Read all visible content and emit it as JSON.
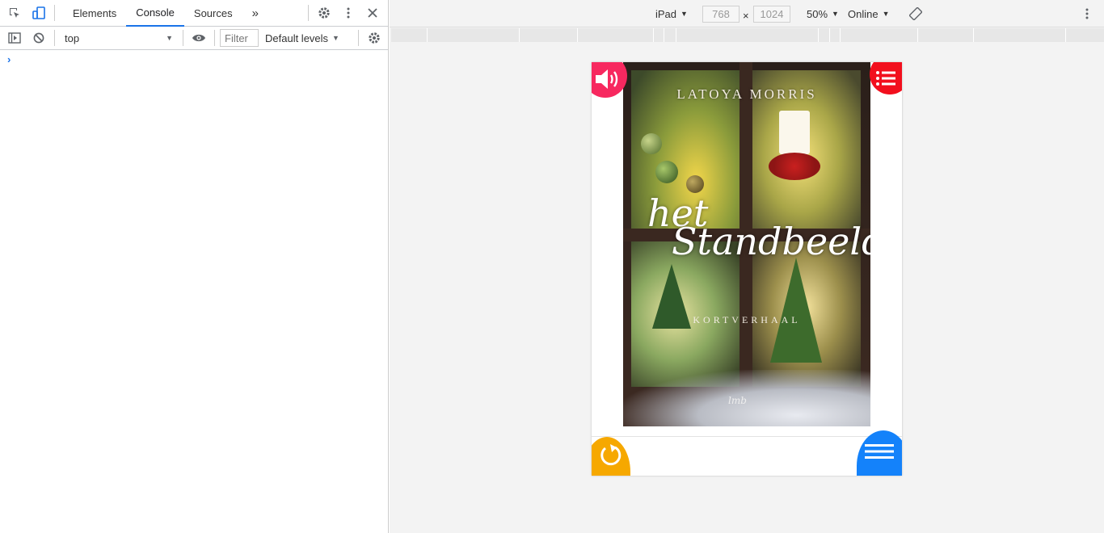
{
  "devtools": {
    "tabs": [
      {
        "label": "Elements",
        "active": false
      },
      {
        "label": "Console",
        "active": true
      },
      {
        "label": "Sources",
        "active": false
      }
    ],
    "more_tabs_glyph": "»",
    "context": "top",
    "filter_placeholder": "Filter",
    "levels": "Default levels",
    "prompt_glyph": "›",
    "icons": [
      "inspect-icon",
      "device-toggle-icon",
      "settings-icon",
      "kebab-icon",
      "close-icon",
      "sidebar-icon",
      "clear-icon",
      "eye-icon"
    ]
  },
  "device_toolbar": {
    "device": "iPad",
    "width": "768",
    "height": "1024",
    "times": "×",
    "zoom": "50%",
    "network": "Online"
  },
  "book": {
    "author": "LATOYA MORRIS",
    "title_line1": "het",
    "title_line2": "Standbeeld",
    "subtitle": "KORTVERHAAL",
    "publisher_mark": "lmb"
  },
  "colors": {
    "sound_button": "#f7285f",
    "toc_button": "#f20f1d",
    "reload_button": "#f6a800",
    "menu_button": "#1482fa",
    "devtools_active_tab": "#1a73e8"
  }
}
